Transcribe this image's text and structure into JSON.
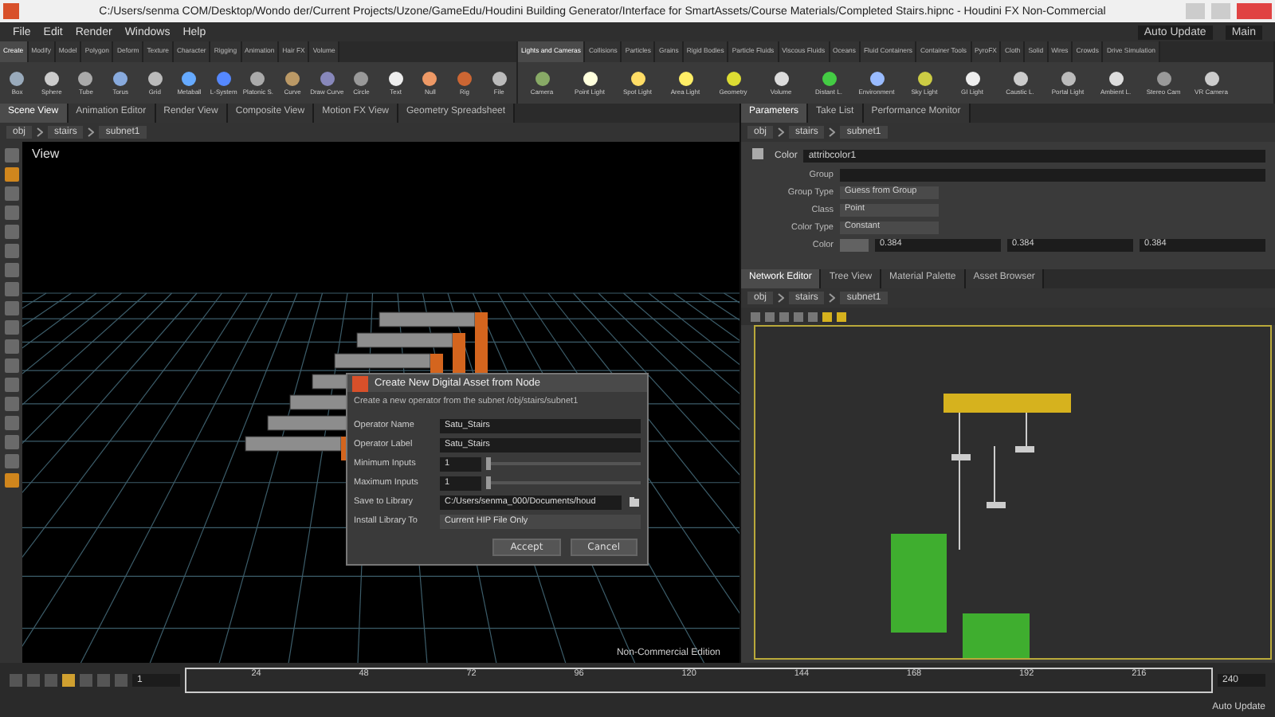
{
  "window": {
    "title": "C:/Users/senma COM/Desktop/Wondo der/Current Projects/Uzone/GameEdu/Houdini Building Generator/Interface for SmartAssets/Course Materials/Completed Stairs.hipnc - Houdini FX Non-Commercial"
  },
  "menu": [
    "File",
    "Edit",
    "Render",
    "Windows",
    "Help"
  ],
  "top_right": {
    "update_mode": "Auto Update",
    "desktop": "Main"
  },
  "shelf_left": {
    "tabs": [
      {
        "label": "Create",
        "selected": true
      },
      {
        "label": "Modify",
        "selected": false
      },
      {
        "label": "Model",
        "selected": false
      },
      {
        "label": "Polygon",
        "selected": false
      },
      {
        "label": "Deform",
        "selected": false
      },
      {
        "label": "Texture",
        "selected": false
      },
      {
        "label": "Character",
        "selected": false
      },
      {
        "label": "Rigging",
        "selected": false
      },
      {
        "label": "Animation",
        "selected": false
      },
      {
        "label": "Hair FX",
        "selected": false
      },
      {
        "label": "Volume",
        "selected": false
      }
    ],
    "tools": [
      "Box",
      "Sphere",
      "Tube",
      "Torus",
      "Grid",
      "Metaball",
      "L-System",
      "Platonic S.",
      "Curve",
      "Draw Curve",
      "Circle",
      "Text",
      "Null",
      "Rig",
      "File"
    ]
  },
  "shelf_right": {
    "tabs": [
      {
        "label": "Lights and Cameras",
        "selected": true
      },
      {
        "label": "Collisions",
        "selected": false
      },
      {
        "label": "Particles",
        "selected": false
      },
      {
        "label": "Grains",
        "selected": false
      },
      {
        "label": "Rigid Bodies",
        "selected": false
      },
      {
        "label": "Particle Fluids",
        "selected": false
      },
      {
        "label": "Viscous Fluids",
        "selected": false
      },
      {
        "label": "Oceans",
        "selected": false
      },
      {
        "label": "Fluid Containers",
        "selected": false
      },
      {
        "label": "Container Tools",
        "selected": false
      },
      {
        "label": "PyroFX",
        "selected": false
      },
      {
        "label": "Cloth",
        "selected": false
      },
      {
        "label": "Solid",
        "selected": false
      },
      {
        "label": "Wires",
        "selected": false
      },
      {
        "label": "Crowds",
        "selected": false
      },
      {
        "label": "Drive Simulation",
        "selected": false
      }
    ],
    "tools": [
      "Camera",
      "Point Light",
      "Spot Light",
      "Area Light",
      "Geometry",
      "Volume",
      "Distant L.",
      "Environment",
      "Sky Light",
      "GI Light",
      "Caustic L.",
      "Portal Light",
      "Ambient L.",
      "Stereo Cam",
      "VR Camera"
    ]
  },
  "left_pane": {
    "tabs": [
      {
        "label": "Scene View",
        "selected": true
      },
      {
        "label": "Animation Editor",
        "selected": false
      },
      {
        "label": "Render View",
        "selected": false
      },
      {
        "label": "Composite View",
        "selected": false
      },
      {
        "label": "Motion FX View",
        "selected": false
      },
      {
        "label": "Geometry Spreadsheet",
        "selected": false
      }
    ],
    "path": [
      "obj",
      "stairs",
      "subnet1"
    ],
    "view_label": "View",
    "status": "Non-Commercial Edition"
  },
  "dialog": {
    "title": "Create New Digital Asset from Node",
    "description": "Create a new operator from the subnet /obj/stairs/subnet1",
    "fields": [
      {
        "kind": "text",
        "label": "Operator Name",
        "value": "Satu_Stairs"
      },
      {
        "kind": "text",
        "label": "Operator Label",
        "value": "Satu_Stairs"
      },
      {
        "kind": "slider",
        "label": "Minimum Inputs",
        "value": "1",
        "level": 0
      },
      {
        "kind": "slider",
        "label": "Maximum Inputs",
        "value": "1",
        "level": 0
      },
      {
        "kind": "file",
        "label": "Save to Library",
        "value": "C:/Users/senma_000/Documents/houd"
      },
      {
        "kind": "menu",
        "label": "Install Library To",
        "value": "Current HIP File Only"
      }
    ],
    "buttons": [
      "Accept",
      "Cancel"
    ]
  },
  "parameters": {
    "tabs": [
      {
        "label": "Parameters",
        "selected": true
      },
      {
        "label": "Take List",
        "selected": false
      },
      {
        "label": "Performance Monitor",
        "selected": false
      }
    ],
    "path": [
      "obj",
      "stairs",
      "subnet1"
    ],
    "node_type": "Color",
    "node_name": "attribcolor1",
    "rows": [
      {
        "kind": "text",
        "label": "Group"
      },
      {
        "kind": "menu",
        "label": "Group Type",
        "value": "Guess from Group"
      },
      {
        "kind": "menu",
        "label": "Class",
        "value": "Point"
      },
      {
        "kind": "menu",
        "label": "Color Type",
        "value": "Constant"
      },
      {
        "kind": "color",
        "label": "Color",
        "values": [
          "0.384",
          "0.384",
          "0.384"
        ]
      }
    ]
  },
  "network": {
    "tabs": [
      {
        "label": "Network Editor",
        "selected": true
      },
      {
        "label": "Tree View",
        "selected": false
      },
      {
        "label": "Material Palette",
        "selected": false
      },
      {
        "label": "Asset Browser",
        "selected": false
      }
    ],
    "path": [
      "obj",
      "stairs",
      "subnet1"
    ]
  },
  "timeline": {
    "frame": "1",
    "ticks": [
      "24",
      "48",
      "72",
      "96",
      "120",
      "144",
      "168",
      "192",
      "216"
    ],
    "end": "240",
    "update_mode": "Auto Update"
  }
}
